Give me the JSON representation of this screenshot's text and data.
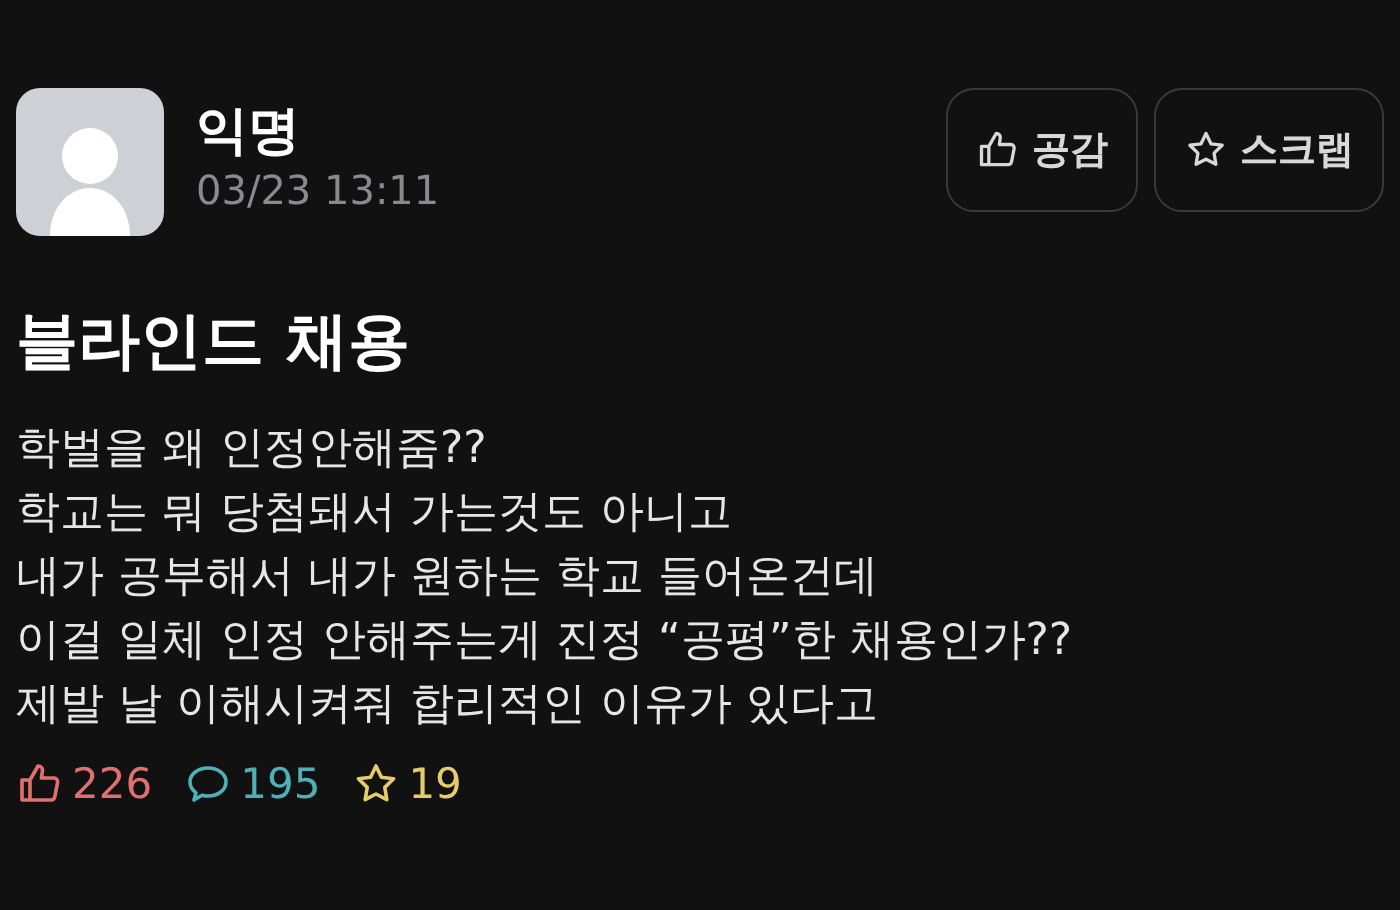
{
  "author": {
    "name": "익명",
    "time": "03/23 13:11"
  },
  "actions": [
    {
      "kind": "like",
      "label": "공감"
    },
    {
      "kind": "scrap",
      "label": "스크랩"
    }
  ],
  "title": "블라인드 채용",
  "body": [
    "학벌을 왜 인정안해줌??",
    "학교는 뭐 당첨돼서 가는것도 아니고",
    "내가 공부해서 내가 원하는 학교 들어온건데",
    "이걸 일체 인정 안해주는게 진정 “공평”한 채용인가??",
    "제발 날 이해시켜줘 합리적인 이유가 있다고"
  ],
  "stats": [
    {
      "kind": "like",
      "count": "226",
      "color": "#e0706e"
    },
    {
      "kind": "comment",
      "count": "195",
      "color": "#4fb0b5"
    },
    {
      "kind": "scrap",
      "count": "19",
      "color": "#e5cc6a"
    }
  ]
}
